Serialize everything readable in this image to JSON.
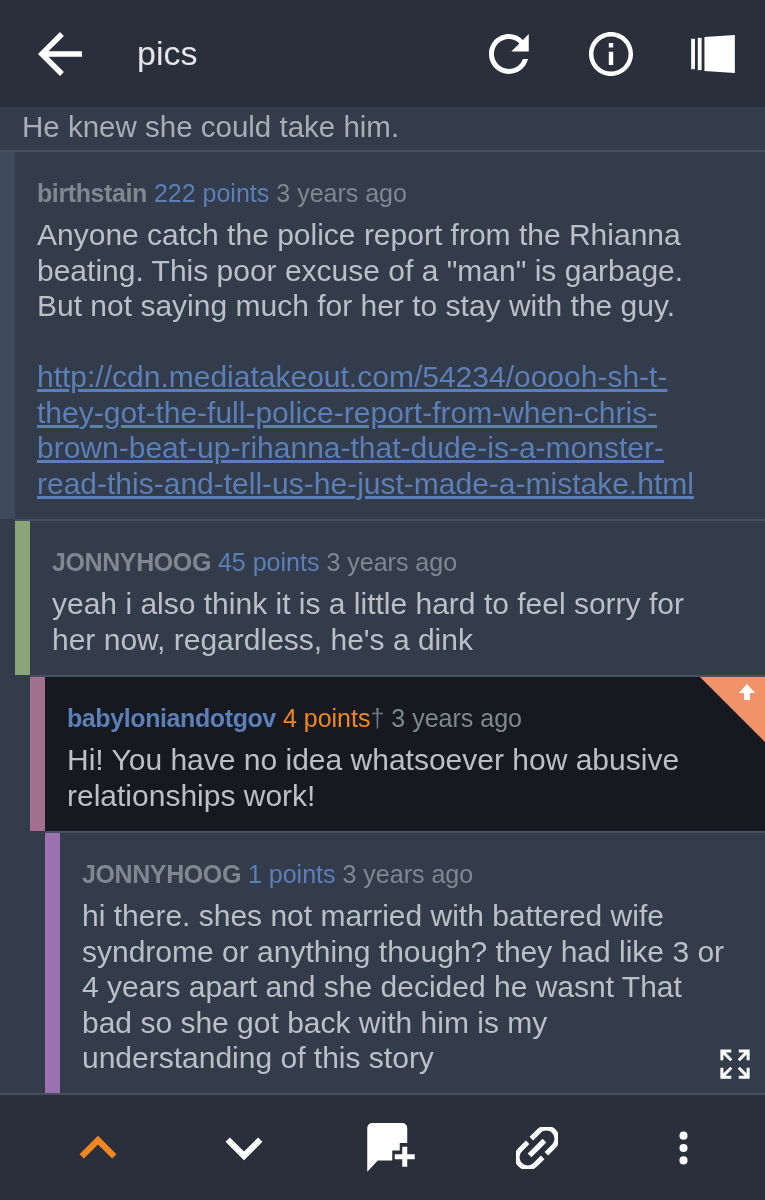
{
  "top_bar": {
    "title": "pics"
  },
  "partial_comment": {
    "text": "He knew she could take him."
  },
  "comments": [
    {
      "author": "birthstain",
      "own_comment": false,
      "points": "222 points",
      "upvoted": false,
      "time": "3 years ago",
      "body": "Anyone catch the police report from the Rhianna beating. This poor excuse of a \"man\" is garbage. But not saying much for her to stay with the guy.",
      "link": "http://cdn.mediatakeout.com/54234/ooooh-sh-t-they-got-the-full-police-report-from-when-chris-brown-beat-up-rihanna-that-dude-is-a-monster-read-this-and-tell-us-he-just-made-a-mistake.html",
      "selected": false,
      "color": "#3f4a5b",
      "children": [
        {
          "author": "JONNYHOOG",
          "own_comment": false,
          "points": "45 points",
          "upvoted": false,
          "time": "3 years ago",
          "body": "yeah i also think it is a little hard to feel sorry for her now, regardless, he's a dink",
          "selected": false,
          "color": "#8aa678",
          "children": [
            {
              "author": "babyloniandotgov",
              "own_comment": true,
              "points": "4 points",
              "controversial_mark": "†",
              "upvoted": true,
              "time": "3 years ago",
              "body": "Hi! You have no idea whatsoever how abusive relationships work!",
              "selected": true,
              "color": "#a0708e",
              "children": [
                {
                  "author": "JONNYHOOG",
                  "own_comment": false,
                  "points": "1 points",
                  "upvoted": false,
                  "time": "3 years ago",
                  "body": "hi there. shes not married with battered wife syndrome or anything though? they had like 3 or 4 years apart and she decided he wasnt That bad so she got back with him is my understanding of this story",
                  "selected": false,
                  "color": "#9b72b0"
                }
              ]
            }
          ]
        }
      ]
    }
  ],
  "bottom_bar": {
    "actions": [
      {
        "kind": "upvote",
        "on": true
      },
      {
        "kind": "downvote",
        "on": false
      },
      {
        "kind": "reply",
        "on": false
      },
      {
        "kind": "link",
        "on": false
      },
      {
        "kind": "more",
        "on": false
      }
    ]
  }
}
